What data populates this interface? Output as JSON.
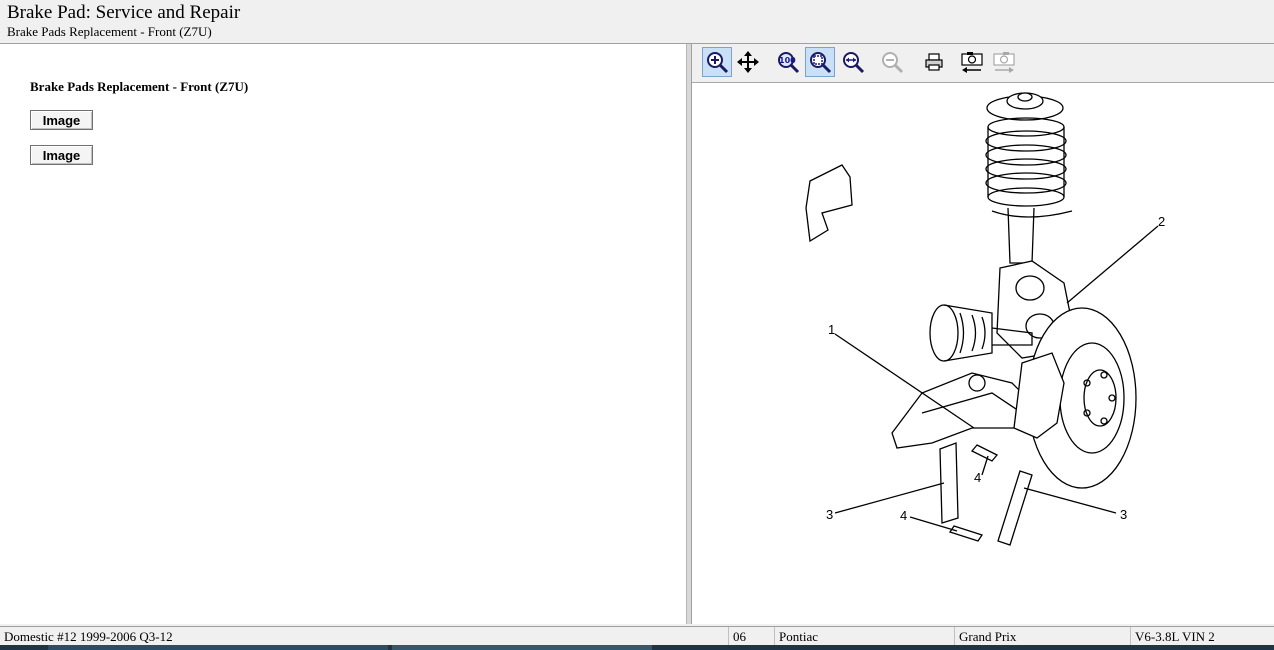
{
  "header": {
    "title": "Brake Pad:  Service and Repair",
    "subtitle": "Brake Pads Replacement - Front (Z7U)"
  },
  "document": {
    "heading": "Brake Pads Replacement - Front (Z7U)",
    "buttons": [
      "Image",
      "Image"
    ]
  },
  "toolbar": {
    "icons": [
      "zoom-in-icon",
      "pan-icon",
      "zoom-100-icon",
      "zoom-fit-icon",
      "zoom-width-icon",
      "zoom-out-icon",
      "print-icon",
      "previous-image-icon",
      "next-image-icon"
    ]
  },
  "diagram": {
    "callouts": [
      "1",
      "2",
      "3",
      "3",
      "4",
      "4"
    ]
  },
  "status": {
    "database": "Domestic #12 1999-2006 Q3-12",
    "year": "06",
    "make": "Pontiac",
    "model": "Grand Prix",
    "engine": "V6-3.8L VIN 2"
  }
}
